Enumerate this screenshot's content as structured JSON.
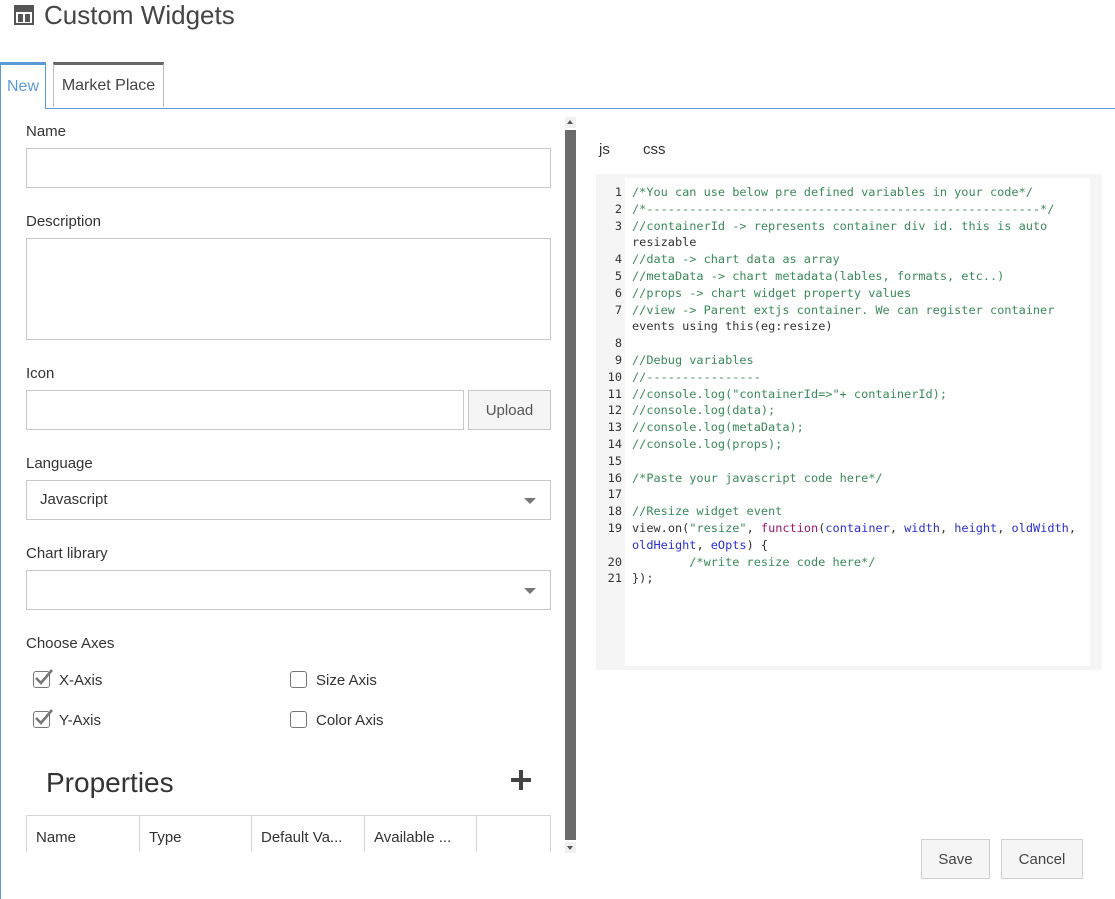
{
  "page": {
    "title": "Custom Widgets",
    "title_icon": "window-layout-icon"
  },
  "tabs": [
    {
      "label": "New",
      "active": true
    },
    {
      "label": "Market Place",
      "active": false
    }
  ],
  "form": {
    "name": {
      "label": "Name",
      "value": ""
    },
    "description": {
      "label": "Description",
      "value": ""
    },
    "icon": {
      "label": "Icon",
      "value": "",
      "upload_label": "Upload"
    },
    "language": {
      "label": "Language",
      "value": "Javascript"
    },
    "chart_library": {
      "label": "Chart library",
      "value": ""
    },
    "axes": {
      "label": "Choose Axes",
      "items": [
        {
          "label": "X-Axis",
          "checked": true
        },
        {
          "label": "Size Axis",
          "checked": false
        },
        {
          "label": "Y-Axis",
          "checked": true
        },
        {
          "label": "Color Axis",
          "checked": false
        }
      ]
    },
    "properties": {
      "title": "Properties",
      "columns": [
        "Name",
        "Type",
        "Default Va...",
        "Available ...",
        ""
      ]
    }
  },
  "editor": {
    "tabs": [
      "js",
      "css"
    ],
    "lines": [
      "/*You can use below pre defined variables in your code*/",
      "/*-------------------------------------------------------*/",
      "//containerId -> represents container div id. this is auto resizable",
      "//data -> chart data as array",
      "//metaData -> chart metadata(lables, formats, etc..)",
      "//props -> chart widget property values",
      "//view -> Parent extjs container. We can register container events using this(eg:resize)",
      "",
      "//Debug variables",
      "//----------------",
      "//console.log(\"containerId=>\"+ containerId);",
      "//console.log(data);",
      "//console.log(metaData);",
      "//console.log(props);",
      "",
      "/*Paste your javascript code here*/",
      "",
      "//Resize widget event",
      "view.on(\"resize\", function(container, width, height, oldWidth, oldHeight, eOpts) {",
      "        /*write resize code here*/",
      "});"
    ]
  },
  "footer": {
    "save_label": "Save",
    "cancel_label": "Cancel"
  },
  "colors": {
    "accent": "#5b9bd5",
    "comment": "#3b8a5a",
    "keyword": "#9c1475",
    "variable": "#2a2fd0"
  }
}
